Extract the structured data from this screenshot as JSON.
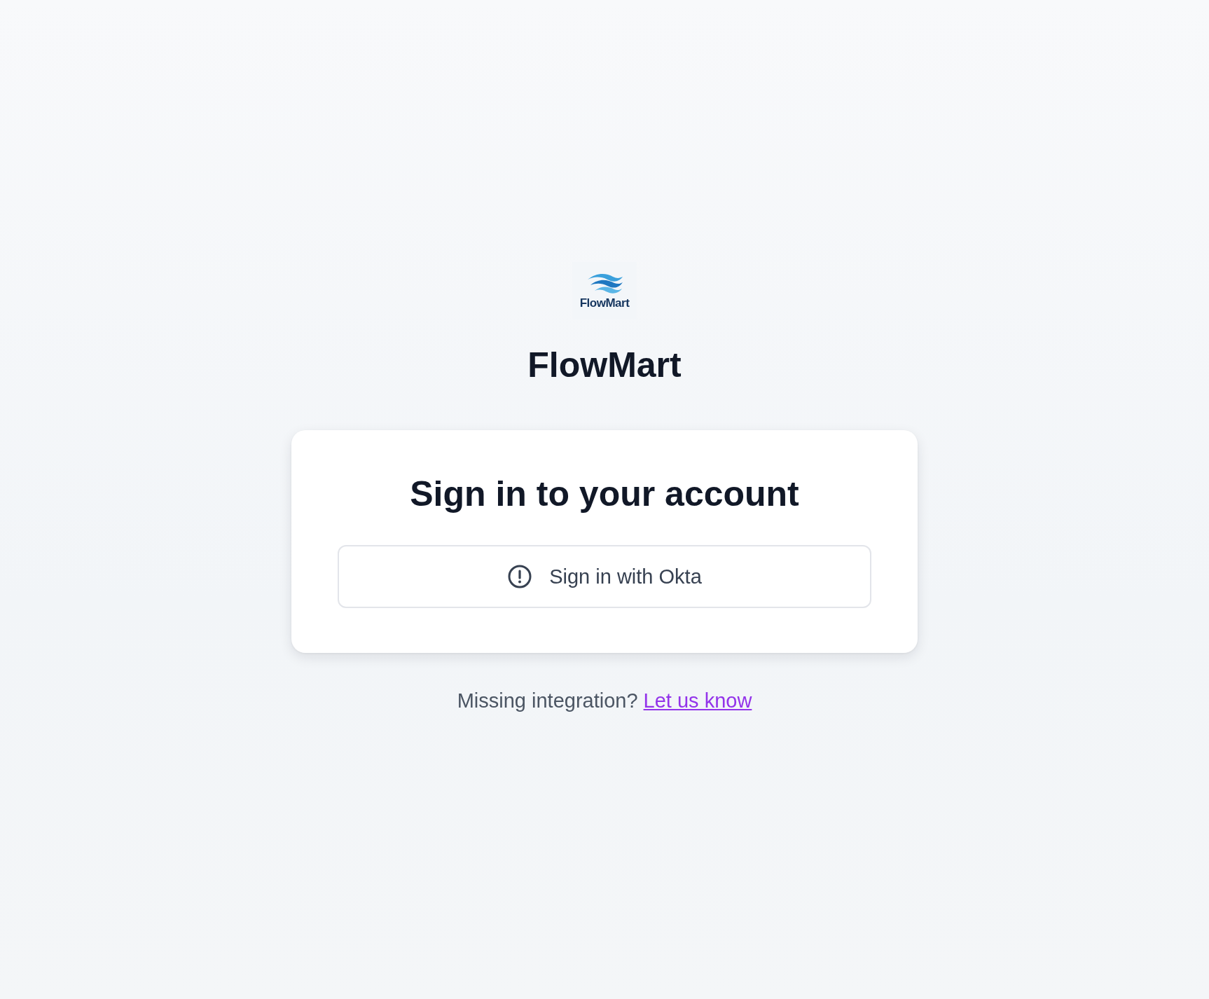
{
  "logo": {
    "text": "FlowMart"
  },
  "app_name": "FlowMart",
  "card": {
    "heading": "Sign in to your account",
    "button": "Sign in with Okta"
  },
  "footer": {
    "text": "Missing integration?",
    "link": "Let us know"
  }
}
